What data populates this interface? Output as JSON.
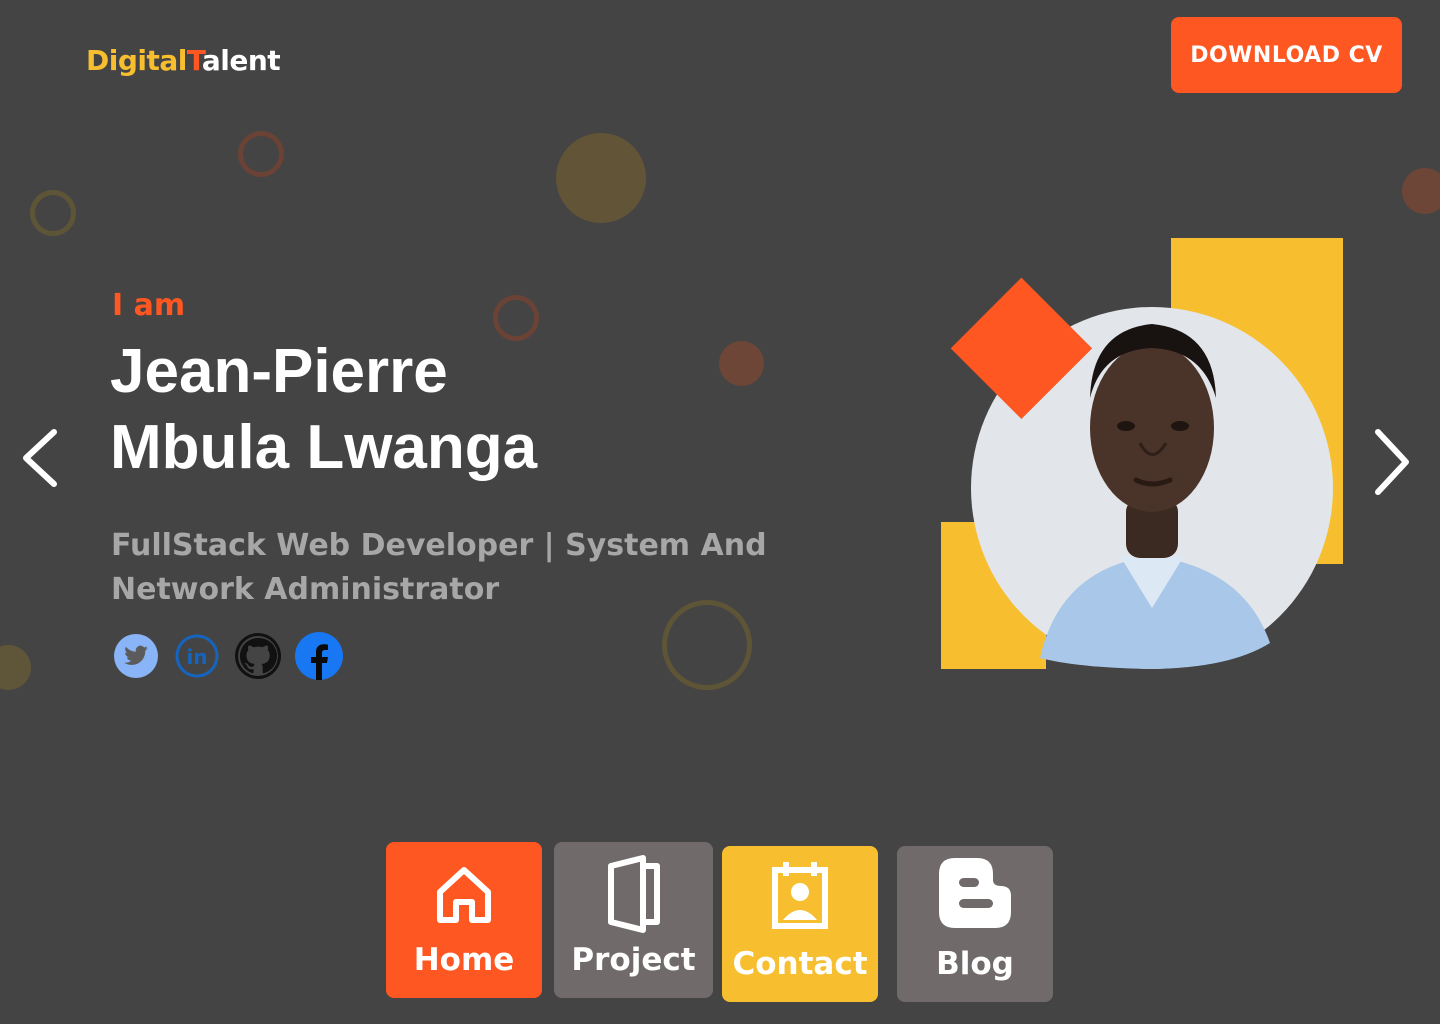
{
  "brand": {
    "part1": "Digital",
    "part2": "T",
    "part3": "alent"
  },
  "header": {
    "download_label": "DOWNLOAD CV"
  },
  "hero": {
    "intro": "I am",
    "name_line1": "Jean-Pierre",
    "name_line2": "Mbula Lwanga",
    "subtitle": "FullStack Web Developer | System And Network Administrator"
  },
  "social": [
    "twitter-icon",
    "linkedin-icon",
    "github-icon",
    "facebook-icon"
  ],
  "nav": [
    {
      "label": "Home",
      "icon": "home-icon",
      "color": "#FF5722"
    },
    {
      "label": "Project",
      "icon": "door-icon",
      "color": "#706B6A"
    },
    {
      "label": "Contact",
      "icon": "contact-card-icon",
      "color": "#F7BE2F"
    },
    {
      "label": "Blog",
      "icon": "blogger-icon",
      "color": "#706B6A"
    }
  ],
  "colors": {
    "accent": "#FF5722",
    "yellow": "#F7BE2F",
    "background": "#444444",
    "muted": "#A7A7A7"
  }
}
